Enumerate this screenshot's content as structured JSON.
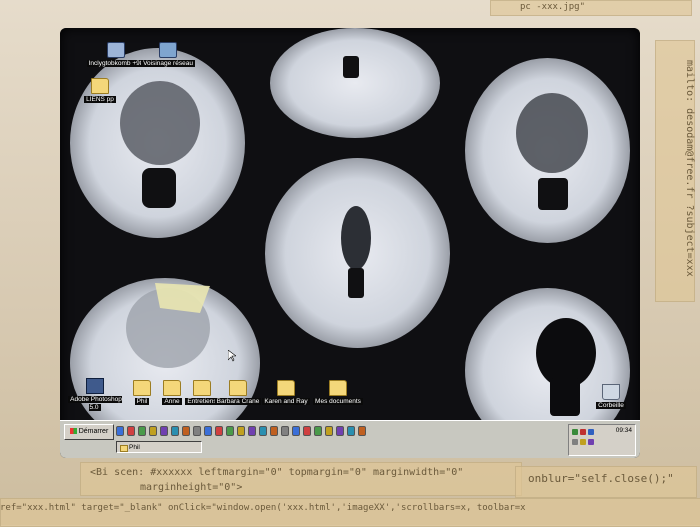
{
  "desktop": {
    "icons": [
      {
        "label": "Inclygtobkomb +98",
        "kind": "computer"
      },
      {
        "label": "Voisinage réseau",
        "kind": "network"
      },
      {
        "label": "LIENS pp",
        "kind": "folder"
      },
      {
        "label": "Adobe Photoshop 5.0",
        "kind": "app"
      },
      {
        "label": "Phil",
        "kind": "folder"
      },
      {
        "label": "Anne",
        "kind": "folder"
      },
      {
        "label": "Entretiens",
        "kind": "folder"
      },
      {
        "label": "Barbara Crane",
        "kind": "folder"
      },
      {
        "label": "Karen and Ray",
        "kind": "folder"
      },
      {
        "label": "Mes documents",
        "kind": "folder"
      },
      {
        "label": "Corbeille",
        "kind": "recycle"
      }
    ]
  },
  "taskbar": {
    "start_label": "Démarrer",
    "task_label": "Phil",
    "clock": "09:34",
    "quick_launch_colors": [
      "#3a6fd8",
      "#d04040",
      "#4a9a4a",
      "#c0a020",
      "#7040b0",
      "#2a8fb0",
      "#c06020",
      "#808080",
      "#3a6fd8",
      "#d04040",
      "#4a9a4a",
      "#c0a020",
      "#7040b0",
      "#2a8fb0",
      "#c06020",
      "#808080",
      "#3a6fd8",
      "#d04040",
      "#4a9a4a",
      "#c0a020",
      "#7040b0",
      "#2a8fb0",
      "#c06020"
    ]
  },
  "notes": {
    "bottom_line1": "<Bi scen: #xxxxxx leftmargin=\"0\" topmargin=\"0\" marginwidth=\"0\"",
    "bottom_line2": "marginheight=\"0\">",
    "bottom_line3": "ref=\"xxx.html\" target=\"_blank\" onClick=\"window.open('xxx.html','imageXX','scrollbars=x, toolbar=x",
    "bottom_right": "onblur=\"self.close();\"",
    "right_side": "mailto: desodam@free.fr ?subject=xxx",
    "top_right": "pc -xxx.jpg\""
  },
  "colors": {
    "screen_bg": "#0f0f12",
    "taskbar": "#c8c8c0"
  }
}
